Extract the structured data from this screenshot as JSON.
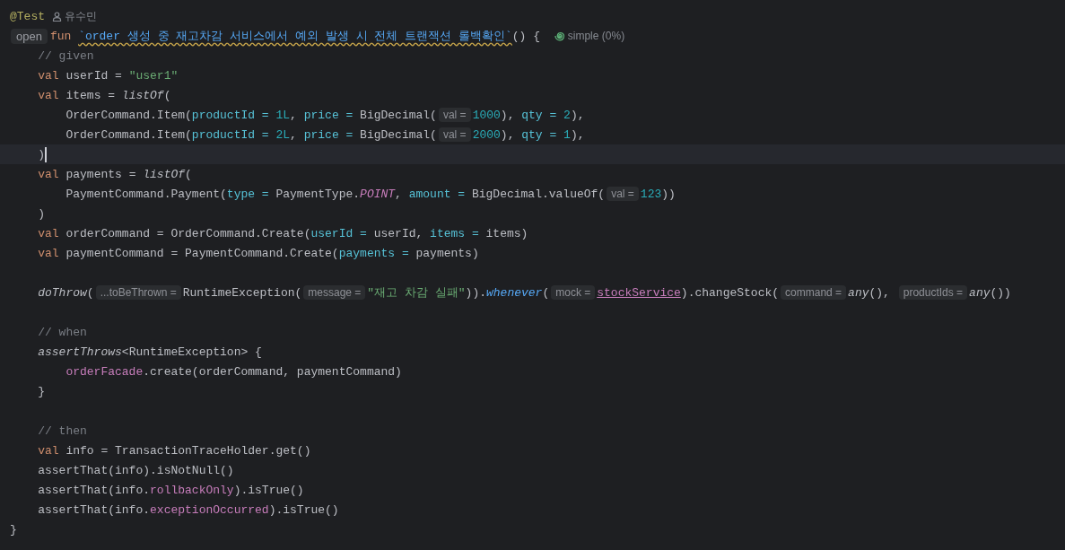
{
  "editor": {
    "lines": [
      {
        "current": false,
        "tokens": [
          {
            "kind": "ann",
            "t": "@Test"
          },
          {
            "kind": "author",
            "t": "유수민"
          }
        ]
      },
      {
        "current": false,
        "tokens": [
          {
            "kind": "badge",
            "t": "open"
          },
          {
            "kind": "kw",
            "t": "fun "
          },
          {
            "kind": "fname",
            "t": "`order 생성 중 재고차감 서비스에서 예외 발생 시 전체 트랜잭션 롤백확인`"
          },
          {
            "kind": "plain",
            "t": "() { "
          },
          {
            "kind": "complexity",
            "t": "simple (0%)"
          }
        ]
      },
      {
        "current": false,
        "tokens": [
          {
            "kind": "comment",
            "t": "    // given"
          }
        ]
      },
      {
        "current": false,
        "tokens": [
          {
            "kind": "kw",
            "t": "    val "
          },
          {
            "kind": "plain",
            "t": "userId = "
          },
          {
            "kind": "str",
            "t": "\"user1\""
          }
        ]
      },
      {
        "current": false,
        "tokens": [
          {
            "kind": "kw",
            "t": "    val "
          },
          {
            "kind": "plain",
            "t": "items = "
          },
          {
            "kind": "call",
            "t": "listOf"
          },
          {
            "kind": "plain",
            "t": "("
          }
        ]
      },
      {
        "current": false,
        "tokens": [
          {
            "kind": "plain",
            "t": "        OrderCommand.Item("
          },
          {
            "kind": "arg",
            "t": "productId = "
          },
          {
            "kind": "num",
            "t": "1L"
          },
          {
            "kind": "plain",
            "t": ", "
          },
          {
            "kind": "arg",
            "t": "price = "
          },
          {
            "kind": "plain",
            "t": "BigDecimal("
          },
          {
            "kind": "hint",
            "t": "val ="
          },
          {
            "kind": "num",
            "t": "1000"
          },
          {
            "kind": "plain",
            "t": "), "
          },
          {
            "kind": "arg",
            "t": "qty = "
          },
          {
            "kind": "num",
            "t": "2"
          },
          {
            "kind": "plain",
            "t": "),"
          }
        ]
      },
      {
        "current": false,
        "tokens": [
          {
            "kind": "plain",
            "t": "        OrderCommand.Item("
          },
          {
            "kind": "arg",
            "t": "productId = "
          },
          {
            "kind": "num",
            "t": "2L"
          },
          {
            "kind": "plain",
            "t": ", "
          },
          {
            "kind": "arg",
            "t": "price = "
          },
          {
            "kind": "plain",
            "t": "BigDecimal("
          },
          {
            "kind": "hint",
            "t": "val ="
          },
          {
            "kind": "num",
            "t": "2000"
          },
          {
            "kind": "plain",
            "t": "), "
          },
          {
            "kind": "arg",
            "t": "qty = "
          },
          {
            "kind": "num",
            "t": "1"
          },
          {
            "kind": "plain",
            "t": "),"
          }
        ]
      },
      {
        "current": true,
        "tokens": [
          {
            "kind": "plain",
            "t": "    )"
          }
        ]
      },
      {
        "current": false,
        "tokens": [
          {
            "kind": "kw",
            "t": "    val "
          },
          {
            "kind": "plain",
            "t": "payments = "
          },
          {
            "kind": "call",
            "t": "listOf"
          },
          {
            "kind": "plain",
            "t": "("
          }
        ]
      },
      {
        "current": false,
        "tokens": [
          {
            "kind": "plain",
            "t": "        PaymentCommand.Payment("
          },
          {
            "kind": "arg",
            "t": "type = "
          },
          {
            "kind": "plain",
            "t": "PaymentType."
          },
          {
            "kind": "const",
            "t": "POINT"
          },
          {
            "kind": "plain",
            "t": ", "
          },
          {
            "kind": "arg",
            "t": "amount = "
          },
          {
            "kind": "plain",
            "t": "BigDecimal.valueOf("
          },
          {
            "kind": "hint",
            "t": "val ="
          },
          {
            "kind": "num",
            "t": "123"
          },
          {
            "kind": "plain",
            "t": "))"
          }
        ]
      },
      {
        "current": false,
        "tokens": [
          {
            "kind": "plain",
            "t": "    )"
          }
        ]
      },
      {
        "current": false,
        "tokens": [
          {
            "kind": "kw",
            "t": "    val "
          },
          {
            "kind": "plain",
            "t": "orderCommand = OrderCommand.Create("
          },
          {
            "kind": "arg",
            "t": "userId = "
          },
          {
            "kind": "plain",
            "t": "userId, "
          },
          {
            "kind": "arg",
            "t": "items = "
          },
          {
            "kind": "plain",
            "t": "items)"
          }
        ]
      },
      {
        "current": false,
        "tokens": [
          {
            "kind": "kw",
            "t": "    val "
          },
          {
            "kind": "plain",
            "t": "paymentCommand = PaymentCommand.Create("
          },
          {
            "kind": "arg",
            "t": "payments = "
          },
          {
            "kind": "plain",
            "t": "payments)"
          }
        ]
      },
      {
        "current": false
      },
      {
        "current": false,
        "tokens": [
          {
            "kind": "call",
            "t": "    doThrow"
          },
          {
            "kind": "plain",
            "t": "("
          },
          {
            "kind": "hint",
            "t": "...toBeThrown ="
          },
          {
            "kind": "plain",
            "t": "RuntimeException("
          },
          {
            "kind": "hint",
            "t": "message ="
          },
          {
            "kind": "str",
            "t": "\"재고 차감 실패\""
          },
          {
            "kind": "plain",
            "t": "))."
          },
          {
            "kind": "callb",
            "t": "whenever"
          },
          {
            "kind": "plain",
            "t": "("
          },
          {
            "kind": "hint",
            "t": "mock ="
          },
          {
            "kind": "link",
            "t": "stockService"
          },
          {
            "kind": "plain",
            "t": ").changeStock("
          },
          {
            "kind": "hint",
            "t": "command ="
          },
          {
            "kind": "call",
            "t": "any"
          },
          {
            "kind": "plain",
            "t": "(), "
          },
          {
            "kind": "hint",
            "t": "productIds ="
          },
          {
            "kind": "call",
            "t": "any"
          },
          {
            "kind": "plain",
            "t": "())"
          }
        ]
      },
      {
        "current": false
      },
      {
        "current": false,
        "tokens": [
          {
            "kind": "comment",
            "t": "    // when"
          }
        ]
      },
      {
        "current": false,
        "tokens": [
          {
            "kind": "call",
            "t": "    assertThrows"
          },
          {
            "kind": "plain",
            "t": "<RuntimeException> {"
          }
        ]
      },
      {
        "current": false,
        "tokens": [
          {
            "kind": "field",
            "t": "        orderFacade"
          },
          {
            "kind": "plain",
            "t": ".create(orderCommand, paymentCommand)"
          }
        ]
      },
      {
        "current": false,
        "tokens": [
          {
            "kind": "plain",
            "t": "    }"
          }
        ]
      },
      {
        "current": false
      },
      {
        "current": false,
        "tokens": [
          {
            "kind": "comment",
            "t": "    // then"
          }
        ]
      },
      {
        "current": false,
        "tokens": [
          {
            "kind": "kw",
            "t": "    val "
          },
          {
            "kind": "plain",
            "t": "info = TransactionTraceHolder.get()"
          }
        ]
      },
      {
        "current": false,
        "tokens": [
          {
            "kind": "plain",
            "t": "    assertThat(info).isNotNull()"
          }
        ]
      },
      {
        "current": false,
        "tokens": [
          {
            "kind": "plain",
            "t": "    assertThat(info."
          },
          {
            "kind": "field",
            "t": "rollbackOnly"
          },
          {
            "kind": "plain",
            "t": ").isTrue()"
          }
        ]
      },
      {
        "current": false,
        "tokens": [
          {
            "kind": "plain",
            "t": "    assertThat(info."
          },
          {
            "kind": "field",
            "t": "exceptionOccurred"
          },
          {
            "kind": "plain",
            "t": ").isTrue()"
          }
        ]
      },
      {
        "current": false,
        "tokens": [
          {
            "kind": "plain",
            "t": "}"
          }
        ]
      }
    ]
  }
}
